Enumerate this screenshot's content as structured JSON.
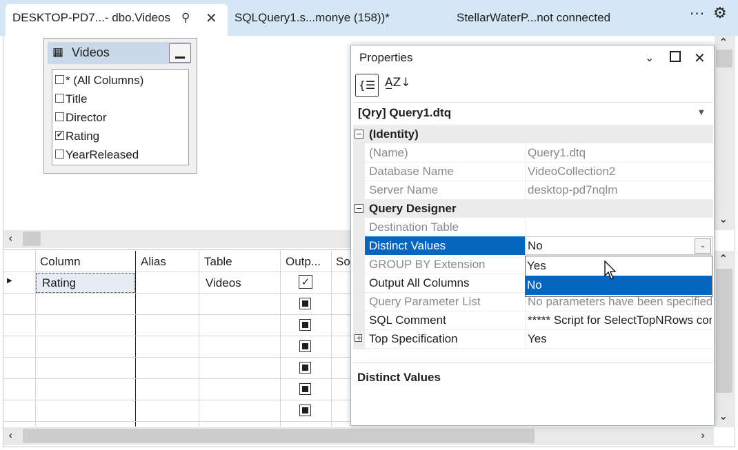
{
  "tabs": {
    "active": {
      "label": "DESKTOP-PD7...- dbo.Videos",
      "pin_icon": "pin-icon",
      "close_icon": "close-icon"
    },
    "second": {
      "label": "SQLQuery1.s...monye (158))*"
    },
    "third": {
      "label": "StellarWaterP...not connected"
    },
    "overflow": "···",
    "settings_icon": "gear-icon"
  },
  "diagram": {
    "table_name": "Videos",
    "columns": [
      {
        "label": "* (All Columns)",
        "checked": false
      },
      {
        "label": "Title",
        "checked": false
      },
      {
        "label": "Director",
        "checked": false
      },
      {
        "label": "Rating",
        "checked": true
      },
      {
        "label": "YearReleased",
        "checked": false
      }
    ]
  },
  "grid": {
    "headers": [
      "Column",
      "Alias",
      "Table",
      "Outp...",
      "So"
    ],
    "rows": [
      {
        "column": "Rating",
        "alias": "",
        "table": "Videos",
        "output": true
      }
    ]
  },
  "properties": {
    "title": "Properties",
    "object": "[Qry] Query1.dtq",
    "categories": [
      {
        "label": "(Identity)",
        "items": [
          {
            "name": "(Name)",
            "value": "Query1.dtq"
          },
          {
            "name": "Database Name",
            "value": "VideoCollection2"
          },
          {
            "name": "Server Name",
            "value": "desktop-pd7nqlm"
          }
        ]
      },
      {
        "label": "Query Designer",
        "items": [
          {
            "name": "Destination Table",
            "value": ""
          },
          {
            "name": "Distinct Values",
            "value": "No"
          },
          {
            "name": "GROUP BY Extension",
            "value": ""
          },
          {
            "name": "Output All Columns",
            "value": ""
          },
          {
            "name": "Query Parameter List",
            "value": "No parameters have been specified"
          },
          {
            "name": "SQL Comment",
            "value": "***** Script for SelectTopNRows command"
          },
          {
            "name": "Top Specification",
            "value": "Yes"
          }
        ]
      }
    ],
    "dropdown_options": [
      "Yes",
      "No"
    ],
    "dropdown_selected": "No",
    "description_title": "Distinct Values"
  },
  "colors": {
    "accent": "#0566c2",
    "tabbar": "#d5e6f5",
    "header": "#c9d9e9"
  }
}
